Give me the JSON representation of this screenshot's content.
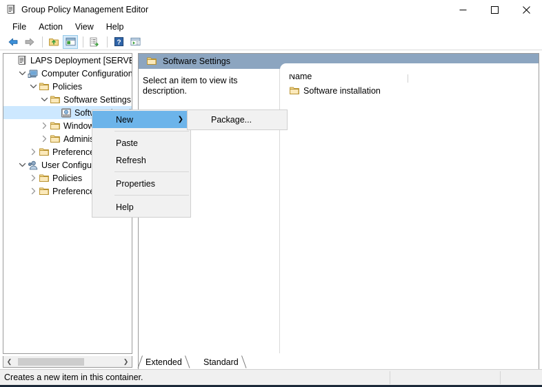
{
  "window": {
    "title": "Group Policy Management Editor",
    "title_icon": "policy-document-icon",
    "minimize_label": "—",
    "maximize_label": "□",
    "close_label": "✕"
  },
  "menubar": {
    "items": [
      {
        "label": "File"
      },
      {
        "label": "Action"
      },
      {
        "label": "View"
      },
      {
        "label": "Help"
      }
    ]
  },
  "toolbar": {
    "buttons": [
      {
        "name": "back-icon"
      },
      {
        "name": "forward-icon"
      },
      {
        "name": "up-folder-icon"
      },
      {
        "name": "show-console-tree-icon"
      },
      {
        "name": "export-list-icon"
      },
      {
        "name": "help-icon"
      },
      {
        "name": "properties-window-icon"
      }
    ]
  },
  "tree": {
    "nodes": [
      {
        "label": "LAPS Deployment [SERVERLAB.",
        "indent": 0,
        "state": "none",
        "icon": "policy-document-icon",
        "selected": false
      },
      {
        "label": "Computer Configuration",
        "indent": 1,
        "state": "expanded",
        "icon": "computer-icon",
        "selected": false
      },
      {
        "label": "Policies",
        "indent": 2,
        "state": "expanded",
        "icon": "folder-icon",
        "selected": false
      },
      {
        "label": "Software Settings",
        "indent": 3,
        "state": "expanded",
        "icon": "folder-icon",
        "selected": false
      },
      {
        "label": "Software installation",
        "indent": 4,
        "state": "none",
        "icon": "software-installation-icon",
        "selected": true
      },
      {
        "label": "Windows Settings",
        "indent": 3,
        "state": "collapsed",
        "icon": "folder-icon",
        "selected": false
      },
      {
        "label": "Administrative Templates",
        "indent": 3,
        "state": "collapsed",
        "icon": "folder-icon",
        "selected": false
      },
      {
        "label": "Preferences",
        "indent": 2,
        "state": "collapsed",
        "icon": "folder-icon",
        "selected": false
      },
      {
        "label": "User Configuration",
        "indent": 1,
        "state": "expanded",
        "icon": "user-icon",
        "selected": false
      },
      {
        "label": "Policies",
        "indent": 2,
        "state": "collapsed",
        "icon": "folder-icon",
        "selected": false
      },
      {
        "label": "Preferences",
        "indent": 2,
        "state": "collapsed",
        "icon": "folder-icon",
        "selected": false
      }
    ],
    "scrollbar": {
      "left_arrow": "❮",
      "right_arrow": "❯"
    }
  },
  "right_pane": {
    "header_title": "Software Settings",
    "header_icon": "folder-icon",
    "header_color": "#8ca5c0",
    "description": "Select an item to view its description.",
    "list": {
      "columns": [
        "Name"
      ],
      "rows": [
        {
          "name": "Software installation",
          "icon": "folder-icon"
        }
      ]
    }
  },
  "tabs": {
    "items": [
      {
        "label": "Extended",
        "active": true
      },
      {
        "label": "Standard",
        "active": false
      }
    ]
  },
  "context_menu": {
    "items": [
      {
        "label": "New",
        "highlighted": true,
        "submenu_arrow": "❯"
      },
      {
        "separator": true
      },
      {
        "label": "Paste",
        "highlighted": false
      },
      {
        "label": "Refresh",
        "highlighted": false
      },
      {
        "separator": true
      },
      {
        "label": "Properties",
        "highlighted": false
      },
      {
        "separator": true
      },
      {
        "label": "Help",
        "highlighted": false
      }
    ],
    "submenu": {
      "items": [
        {
          "label": "Package...",
          "highlighted": false
        }
      ]
    }
  },
  "statusbar": {
    "text": "Creates a new item in this container."
  }
}
